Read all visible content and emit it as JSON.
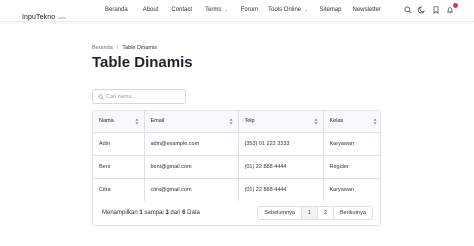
{
  "brand": {
    "name": "InpuTekno",
    "sub": ".com"
  },
  "nav": {
    "items": [
      {
        "label": "Beranda"
      },
      {
        "label": "About"
      },
      {
        "label": "Contact"
      },
      {
        "label": "Terms",
        "dropdown": true
      },
      {
        "label": "Forum"
      },
      {
        "label": "Tools Online",
        "dropdown": true
      },
      {
        "label": "Sitemap"
      },
      {
        "label": "Newsletter"
      }
    ]
  },
  "header_icons": [
    "search-icon",
    "moon-icon",
    "bookmark-icon",
    "bell-icon"
  ],
  "notification_count": "",
  "breadcrumb": {
    "home": "Beranda",
    "separator": "/",
    "current": "Table Dinamis"
  },
  "page_title": "Table Dinamis",
  "search": {
    "placeholder": "Cari nama...",
    "value": ""
  },
  "table": {
    "columns": [
      "Nama",
      "Email",
      "Telp",
      "Kelas"
    ],
    "rows": [
      {
        "nama": "Adin",
        "email": "adin@example.com",
        "telp": "(353) 01 222 3333",
        "kelas": "Karyawan"
      },
      {
        "nama": "Beni",
        "email": "beni@gmail.com",
        "telp": "(01) 22 888 4444",
        "kelas": "Reguler"
      },
      {
        "nama": "Citra",
        "email": "citra@gmail.com",
        "telp": "(01) 22 888 4444",
        "kelas": "Karyawan"
      }
    ]
  },
  "footer": {
    "prefix": "Menampilkan",
    "from": "1",
    "to_word": "sampai",
    "to": "3",
    "of_word": "dari",
    "total": "6",
    "suffix": "Data"
  },
  "pagination": {
    "prev": "Sebelumnya",
    "pages": [
      "1",
      "2"
    ],
    "active_page": "1",
    "next": "Berikutnya"
  },
  "colors": {
    "accent": "#1f2329",
    "border": "#dee2e6",
    "header_bg": "#f8f9fa",
    "badge": "#dc3545"
  }
}
